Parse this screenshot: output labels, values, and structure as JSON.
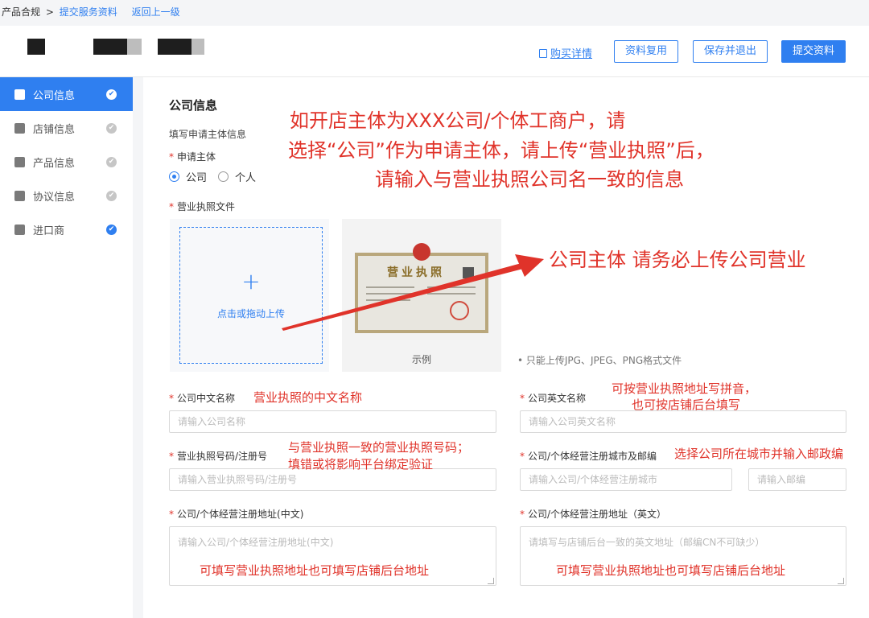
{
  "breadcrumb": {
    "root": "产品合规",
    "sep": ">",
    "current": "提交服务资料",
    "back": "返回上一级"
  },
  "header": {
    "buy_link": "购买详情",
    "btn_reuse": "资料复用",
    "btn_save_exit": "保存并退出",
    "btn_submit": "提交资料"
  },
  "sidebar": {
    "items": [
      {
        "label": "公司信息"
      },
      {
        "label": "店铺信息"
      },
      {
        "label": "产品信息"
      },
      {
        "label": "协议信息"
      },
      {
        "label": "进口商"
      }
    ]
  },
  "form": {
    "section_title": "公司信息",
    "sub_title": "填写申请主体信息",
    "applicant_label": "申请主体",
    "option_company": "公司",
    "option_personal": "个人",
    "license_label": "营业执照文件",
    "upload_plus": "+",
    "upload_text": "点击或拖动上传",
    "example_label": "示例",
    "license_title": "营业执照",
    "upload_hint": "• 只能上传JPG、JPEG、PNG格式文件",
    "cn_name_label": "公司中文名称",
    "cn_name_placeholder": "请输入公司名称",
    "en_name_label": "公司英文名称",
    "en_name_placeholder": "请输入公司英文名称",
    "license_no_label": "营业执照号码/注册号",
    "license_no_placeholder": "请输入营业执照号码/注册号",
    "city_label": "公司/个体经营注册城市及邮编",
    "city_placeholder": "请输入公司/个体经营注册城市",
    "zip_placeholder": "请输入邮编",
    "addr_cn_label": "公司/个体经营注册地址(中文)",
    "addr_cn_placeholder": "请输入公司/个体经营注册地址(中文)",
    "addr_en_label": "公司/个体经营注册地址（英文）",
    "addr_en_placeholder": "请填写与店铺后台一致的英文地址（邮编CN不可缺少）"
  },
  "annotations": {
    "top_line1": "如开店主体为XXX公司/个体工商户，请",
    "top_line2": "选择“公司”作为申请主体，请上传“营业执照”后，",
    "top_line3": "请输入与营业执照公司名一致的信息",
    "arrow_note": "公司主体 请务必上传公司营业",
    "cn_name_note": "营业执照的中文名称",
    "en_name_note1": "可按营业执照地址写拼音，",
    "en_name_note2": "也可按店铺后台填写",
    "license_no_note1": "与营业执照一致的营业执照号码；",
    "license_no_note2": "填错或将影响平台绑定验证",
    "city_note": "选择公司所在城市并输入邮政编",
    "addr_cn_note": "可填写营业执照地址也可填写店铺后台地址",
    "addr_en_note": "可填写营业执照地址也可填写店铺后台地址"
  },
  "colors": {
    "accent": "#2f7ff0",
    "annotation": "#e0332a"
  }
}
